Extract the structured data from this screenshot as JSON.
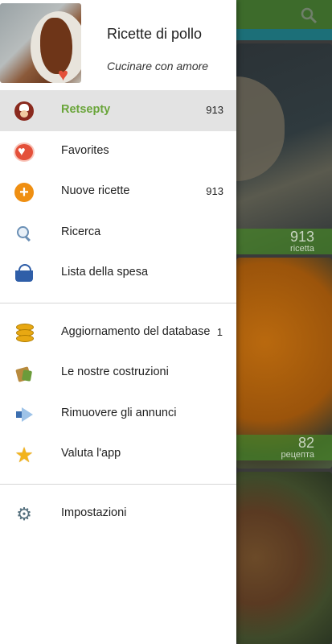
{
  "background": {
    "cards": [
      {
        "count": "913",
        "label": "ricetta"
      },
      {
        "count": "82",
        "label": "рецепта"
      }
    ]
  },
  "drawer": {
    "title": "Ricette di pollo",
    "subtitle": "Cucinare con amore",
    "items": [
      {
        "label": "Retsepty",
        "count": "913",
        "icon": "chef-icon",
        "active": true
      },
      {
        "label": "Favorites",
        "count": "",
        "icon": "heart-icon"
      },
      {
        "label": "Nuove ricette",
        "count": "913",
        "icon": "plus-icon"
      },
      {
        "label": "Ricerca",
        "count": "",
        "icon": "search-icon"
      },
      {
        "label": "Lista della spesa",
        "count": "",
        "icon": "basket-icon"
      }
    ],
    "items2": [
      {
        "label": "Aggiornamento del database",
        "count": "1",
        "icon": "database-icon"
      },
      {
        "label": "Le nostre costruzioni",
        "count": "",
        "icon": "apps-icon"
      },
      {
        "label": "Rimuovere gli annunci",
        "count": "",
        "icon": "megaphone-icon"
      },
      {
        "label": "Valuta l'app",
        "count": "",
        "icon": "star-icon"
      }
    ],
    "items3": [
      {
        "label": "Impostazioni",
        "count": "",
        "icon": "gear-icon"
      }
    ]
  },
  "colors": {
    "active_text": "#6aa53a",
    "active_bg": "#e3e3e3"
  }
}
